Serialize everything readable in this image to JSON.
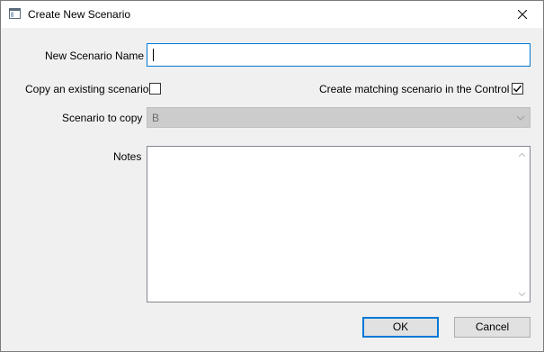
{
  "window": {
    "title": "Create New Scenario",
    "icon": "window-icon",
    "close_icon": "close-icon"
  },
  "form": {
    "name_label": "New Scenario Name",
    "name_value": "",
    "copy_existing_label": "Copy an existing scenario",
    "copy_existing_checked": false,
    "create_matching_label": "Create matching scenario in the Control",
    "create_matching_checked": true,
    "scenario_to_copy_label": "Scenario to copy",
    "scenario_to_copy_value": "B",
    "scenario_to_copy_enabled": false,
    "notes_label": "Notes",
    "notes_value": ""
  },
  "buttons": {
    "ok_label": "OK",
    "cancel_label": "Cancel"
  },
  "colors": {
    "focus_border": "#0078d7",
    "disabled_bg": "#cccccc",
    "dialog_bg": "#f0f0f0"
  }
}
